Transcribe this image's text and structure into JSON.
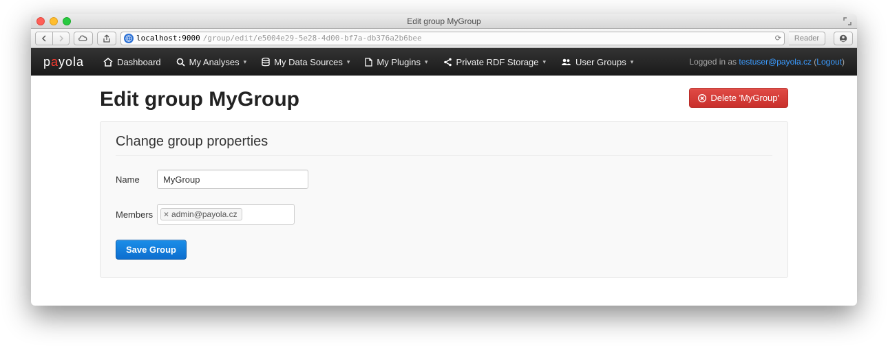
{
  "window": {
    "title": "Edit group MyGroup"
  },
  "url": {
    "host": "localhost:9000",
    "path": "/group/edit/e5004e29-5e28-4d00-bf7a-db376a2b6bee",
    "reader_label": "Reader"
  },
  "nav": {
    "brand_prefix": "p",
    "brand_accent": "a",
    "brand_suffix": "yola",
    "items": [
      {
        "label": "Dashboard",
        "dropdown": false
      },
      {
        "label": "My Analyses",
        "dropdown": true
      },
      {
        "label": "My Data Sources",
        "dropdown": true
      },
      {
        "label": "My Plugins",
        "dropdown": true
      },
      {
        "label": "Private RDF Storage",
        "dropdown": true
      },
      {
        "label": "User Groups",
        "dropdown": true
      }
    ],
    "logged_in_prefix": "Logged in as ",
    "user_email": "testuser@payola.cz",
    "logout_open": " (",
    "logout_label": "Logout",
    "logout_close": ")"
  },
  "page": {
    "heading": "Edit group MyGroup",
    "delete_label": "Delete 'MyGroup'",
    "panel_title": "Change group properties",
    "name_label": "Name",
    "name_value": "MyGroup",
    "members_label": "Members",
    "members": [
      {
        "label": "admin@payola.cz"
      }
    ],
    "save_label": "Save Group"
  }
}
